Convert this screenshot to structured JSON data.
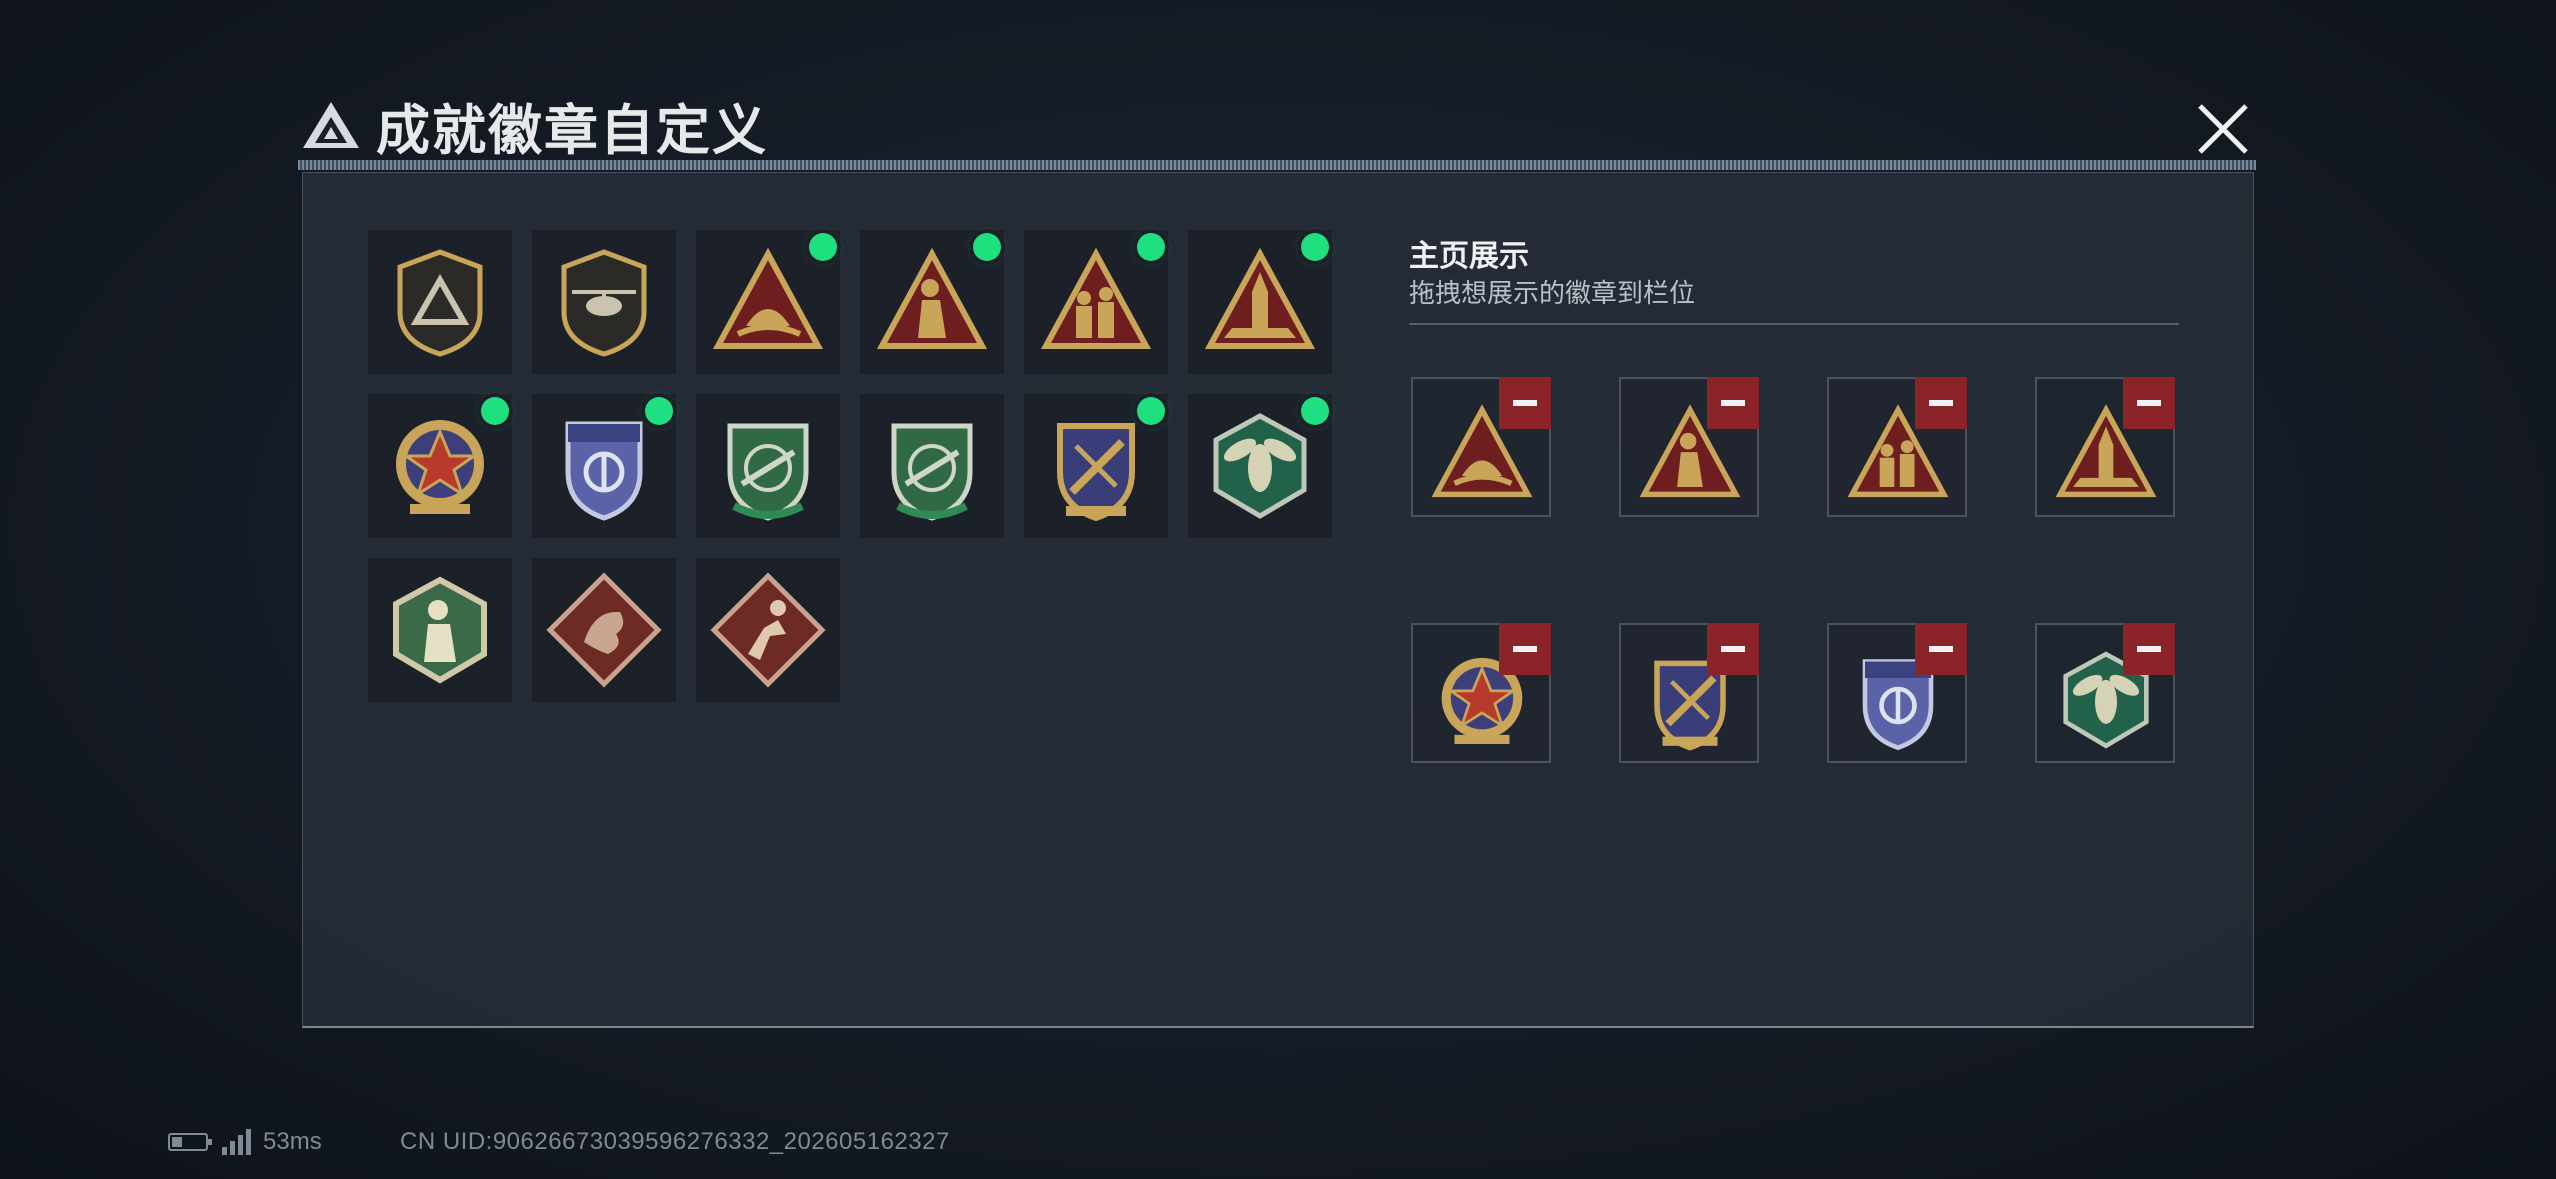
{
  "header": {
    "title": "成就徽章自定义",
    "logo_icon": "triangle-logo-icon",
    "close_icon": "close-icon"
  },
  "colors": {
    "accent_gold": "#c9a559",
    "dark_red": "#7a2020",
    "new_dot": "#1fe07e",
    "remove": "#8b2428"
  },
  "badges": [
    {
      "icon": "shield-triangle-badge-icon",
      "is_new": false
    },
    {
      "icon": "helicopter-badge-icon",
      "is_new": false
    },
    {
      "icon": "helmet-triangle-badge-icon",
      "is_new": true
    },
    {
      "icon": "soldier-kneel-badge-icon",
      "is_new": true
    },
    {
      "icon": "squad-triangle-badge-icon",
      "is_new": true
    },
    {
      "icon": "rocket-triangle-badge-icon",
      "is_new": true
    },
    {
      "icon": "star-round-badge-icon",
      "is_new": true
    },
    {
      "icon": "blue-shield-badge-icon",
      "is_new": true
    },
    {
      "icon": "green-rifle-badge-icon",
      "is_new": false
    },
    {
      "icon": "green-rifle-badge-2-icon",
      "is_new": false
    },
    {
      "icon": "gold-sword-shield-badge-icon",
      "is_new": true
    },
    {
      "icon": "hornet-hex-badge-icon",
      "is_new": true
    },
    {
      "icon": "green-hex-figure-badge-icon",
      "is_new": false
    },
    {
      "icon": "dragon-diamond-badge-icon",
      "is_new": false
    },
    {
      "icon": "runner-diamond-badge-icon",
      "is_new": false
    }
  ],
  "showcase": {
    "title": "主页展示",
    "subtitle": "拖拽想展示的徽章到栏位",
    "slots": [
      {
        "icon": "helmet-triangle-badge-icon"
      },
      {
        "icon": "soldier-kneel-badge-icon"
      },
      {
        "icon": "squad-triangle-badge-icon"
      },
      {
        "icon": "rocket-triangle-badge-icon"
      },
      {
        "icon": "star-round-badge-icon"
      },
      {
        "icon": "gold-sword-shield-badge-icon"
      },
      {
        "icon": "blue-shield-badge-icon"
      },
      {
        "icon": "hornet-hex-badge-icon"
      }
    ]
  },
  "status_bar": {
    "ping": "53ms",
    "uid": "CN UID:9062667303959627633​2_202605162327"
  }
}
